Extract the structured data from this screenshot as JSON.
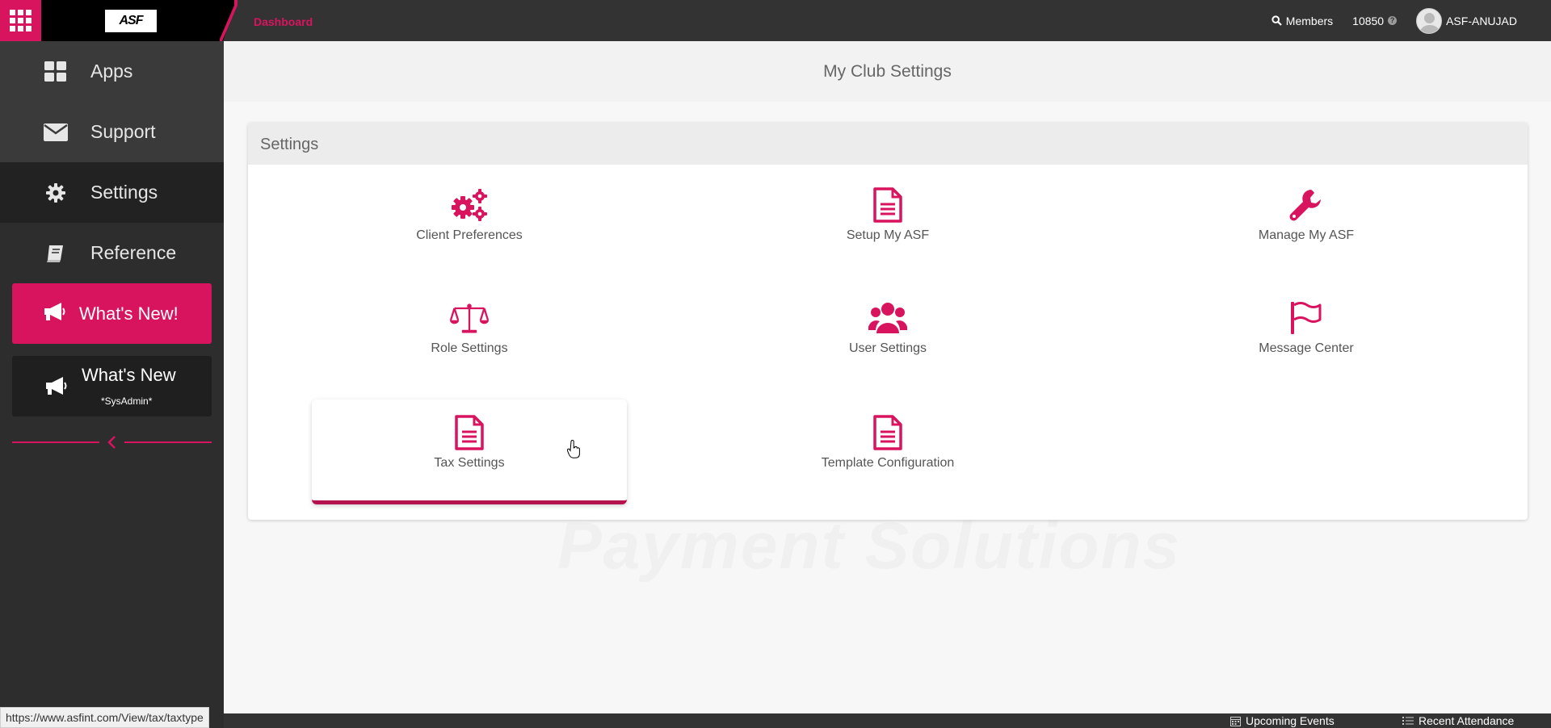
{
  "topbar": {
    "logo": "ASF",
    "breadcrumb": "Dashboard",
    "members_label": "Members",
    "member_count": "10850",
    "help_glyph": "?",
    "username": "ASF-ANUJAD"
  },
  "sidebar": {
    "items": [
      {
        "label": "Apps",
        "icon": "grid-icon"
      },
      {
        "label": "Support",
        "icon": "envelope-icon"
      },
      {
        "label": "Settings",
        "icon": "gear-icon"
      },
      {
        "label": "Reference",
        "icon": "book-icon"
      }
    ],
    "whats_new": "What's New!",
    "whats_new_sys_title": "What's New",
    "whats_new_sys_sub": "*SysAdmin*"
  },
  "main": {
    "title": "My Club Settings",
    "watermark": "Payment Solutions",
    "panel_title": "Settings",
    "tiles": [
      {
        "label": "Client Preferences",
        "icon": "gears-icon"
      },
      {
        "label": "Setup My ASF",
        "icon": "document-icon"
      },
      {
        "label": "Manage My ASF",
        "icon": "wrench-icon"
      },
      {
        "label": "Role Settings",
        "icon": "balance-scale-icon"
      },
      {
        "label": "User Settings",
        "icon": "users-icon"
      },
      {
        "label": "Message Center",
        "icon": "flag-icon"
      },
      {
        "label": "Tax Settings",
        "icon": "document-icon"
      },
      {
        "label": "Template Configuration",
        "icon": "document-icon"
      }
    ]
  },
  "footer": {
    "upcoming_events": "Upcoming Events",
    "recent_attendance": "Recent Attendance"
  },
  "status_url": "https://www.asfint.com/View/tax/taxtype",
  "colors": {
    "accent": "#d8145f",
    "topbar": "#333333",
    "sidebar": "#2d2d2d"
  }
}
